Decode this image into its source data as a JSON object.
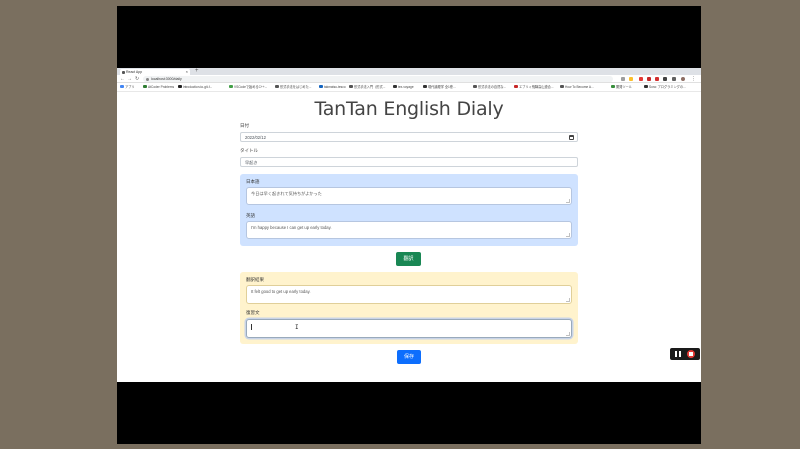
{
  "browser": {
    "tab_title": "React App",
    "url": "localhost:3000/daily",
    "bookmarks": [
      {
        "label": "アプリ",
        "color": "#4285f4"
      },
      {
        "label": "AtCoder Problems",
        "color": "#2e7d32"
      },
      {
        "label": "introduction-to-git-f...",
        "color": "#222222"
      },
      {
        "label": "VSCodeで始めるC++...",
        "color": "#43a047"
      },
      {
        "label": "形式手法をはじめた...",
        "color": "#555555"
      },
      {
        "label": "takmatsu-tesco",
        "color": "#1565c0"
      },
      {
        "label": "形式手法入門（形式...",
        "color": "#555555"
      },
      {
        "label": "tex-voyage",
        "color": "#333333"
      },
      {
        "label": "現代論理学 全1巻...",
        "color": "#333333"
      },
      {
        "label": "形式手法の自然な...",
        "color": "#555555"
      },
      {
        "label": "エブリィ飛騨高山連合...",
        "color": "#c62828"
      },
      {
        "label": "How To Become A...",
        "color": "#555555"
      },
      {
        "label": "開発ツール",
        "color": "#388e3c"
      },
      {
        "label": "Sora: プログラミングの...",
        "color": "#333333"
      }
    ]
  },
  "app": {
    "title": "TanTan English Dialy",
    "date_label": "日付",
    "date_value": "2022/02/12",
    "title_label": "タイトル",
    "title_value": "早起き",
    "japanese_label": "日本語",
    "japanese_value": "今日は早く起きれて気持ちがよかった",
    "english_label": "英語",
    "english_value": "I'm happy because I can get up early today.",
    "translate_button": "翻訳",
    "result_label": "翻訳結果",
    "result_value": "It felt good to get up early today.",
    "review_label": "復習文",
    "review_value": "",
    "save_button": "保存"
  },
  "colors": {
    "blue_section": "#cfe2ff",
    "yellow_section": "#fff3cd",
    "translate_button": "#198754",
    "save_button": "#0d6efd",
    "record_stop": "#e53935"
  }
}
